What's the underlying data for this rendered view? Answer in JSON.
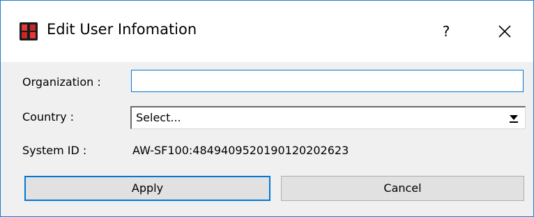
{
  "window": {
    "title": "Edit User Infomation",
    "help_label": "?",
    "app_icon": "app-logo-icon",
    "close_icon": "close-icon",
    "accent_color": "#0078d7"
  },
  "form": {
    "organization": {
      "label": "Organization :",
      "value": ""
    },
    "country": {
      "label": "Country :",
      "selected": "Select...",
      "icon": "dropdown-arrow-icon"
    },
    "system_id": {
      "label": "System ID :",
      "value": "AW-SF100:4849409520190120202623"
    }
  },
  "buttons": {
    "apply_label": "Apply",
    "cancel_label": "Cancel"
  }
}
